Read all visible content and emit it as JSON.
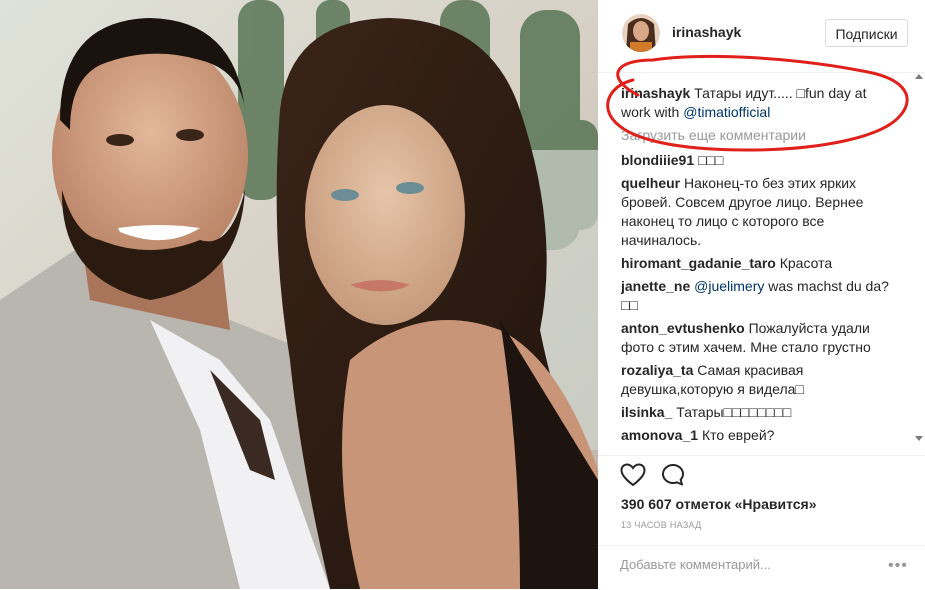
{
  "header": {
    "username": "irinashayk",
    "follow_label": "Подписки"
  },
  "caption": {
    "user": "irinashayk",
    "text_pre": "Татары идут..... □fun day at work with ",
    "mention": "@timatiofficial"
  },
  "load_more": "Загрузить еще комментарии",
  "comments": [
    {
      "user": "blondiiie91",
      "text": "□□□"
    },
    {
      "user": "quelheur",
      "text": "Наконец-то без этих ярких бровей. Совсем другое лицо. Вернее наконец то лицо с которого все начиналось."
    },
    {
      "user": "hiromant_gadanie_taro",
      "text": "Красота"
    },
    {
      "user": "janette_ne",
      "mention": "@juelimery",
      "text": " was machst du da? □□"
    },
    {
      "user": "anton_evtushenko",
      "text": "Пожалуйста удали фото с этим хачем. Мне стало грустно"
    },
    {
      "user": "rozaliya_ta",
      "text": "Самая красивая девушка,которую я видела□"
    },
    {
      "user": "ilsinka_",
      "text": "Татары□□□□□□□□"
    },
    {
      "user": "amonova_1",
      "text": "Кто еврей?"
    }
  ],
  "likes": "390 607 отметок «Нравится»",
  "time_ago": "13 ЧАСОВ НАЗАД",
  "add_comment": {
    "placeholder": "Добавьте комментарий..."
  },
  "more_label": "•••",
  "icons": {
    "like": "heart-icon",
    "comment": "comment-bubble-icon",
    "more": "more-options-icon"
  },
  "colors": {
    "accent_link": "#003569",
    "annotation_red": "#e0201b",
    "muted": "#999999"
  }
}
